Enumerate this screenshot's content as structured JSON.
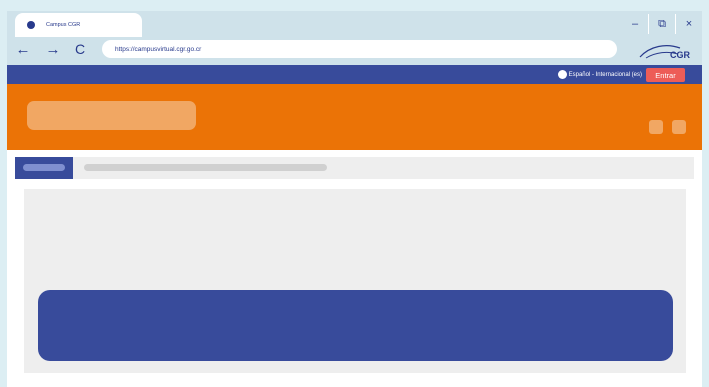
{
  "browser": {
    "tab_title": "Campus CGR",
    "url": "https://campusvirtual.cgr.go.cr",
    "nav": {
      "back_glyph": "←",
      "forward_glyph": "→",
      "reload_glyph": "C"
    },
    "window_controls": {
      "minimize_glyph": "–",
      "maximize_glyph": "⧉",
      "close_glyph": "×"
    }
  },
  "logo": {
    "text": "CGR"
  },
  "topbar": {
    "language": "Español - Internacional (es)",
    "login_label": "Entrar"
  },
  "colors": {
    "page_background": "#dceef3",
    "browser_chrome": "#cfe2ea",
    "navy": "#384b9b",
    "accent_orange": "#eb7306",
    "placeholder_orange": "#f1a763",
    "login_red": "#ed5d57",
    "panel_gray": "#eeeeee"
  }
}
